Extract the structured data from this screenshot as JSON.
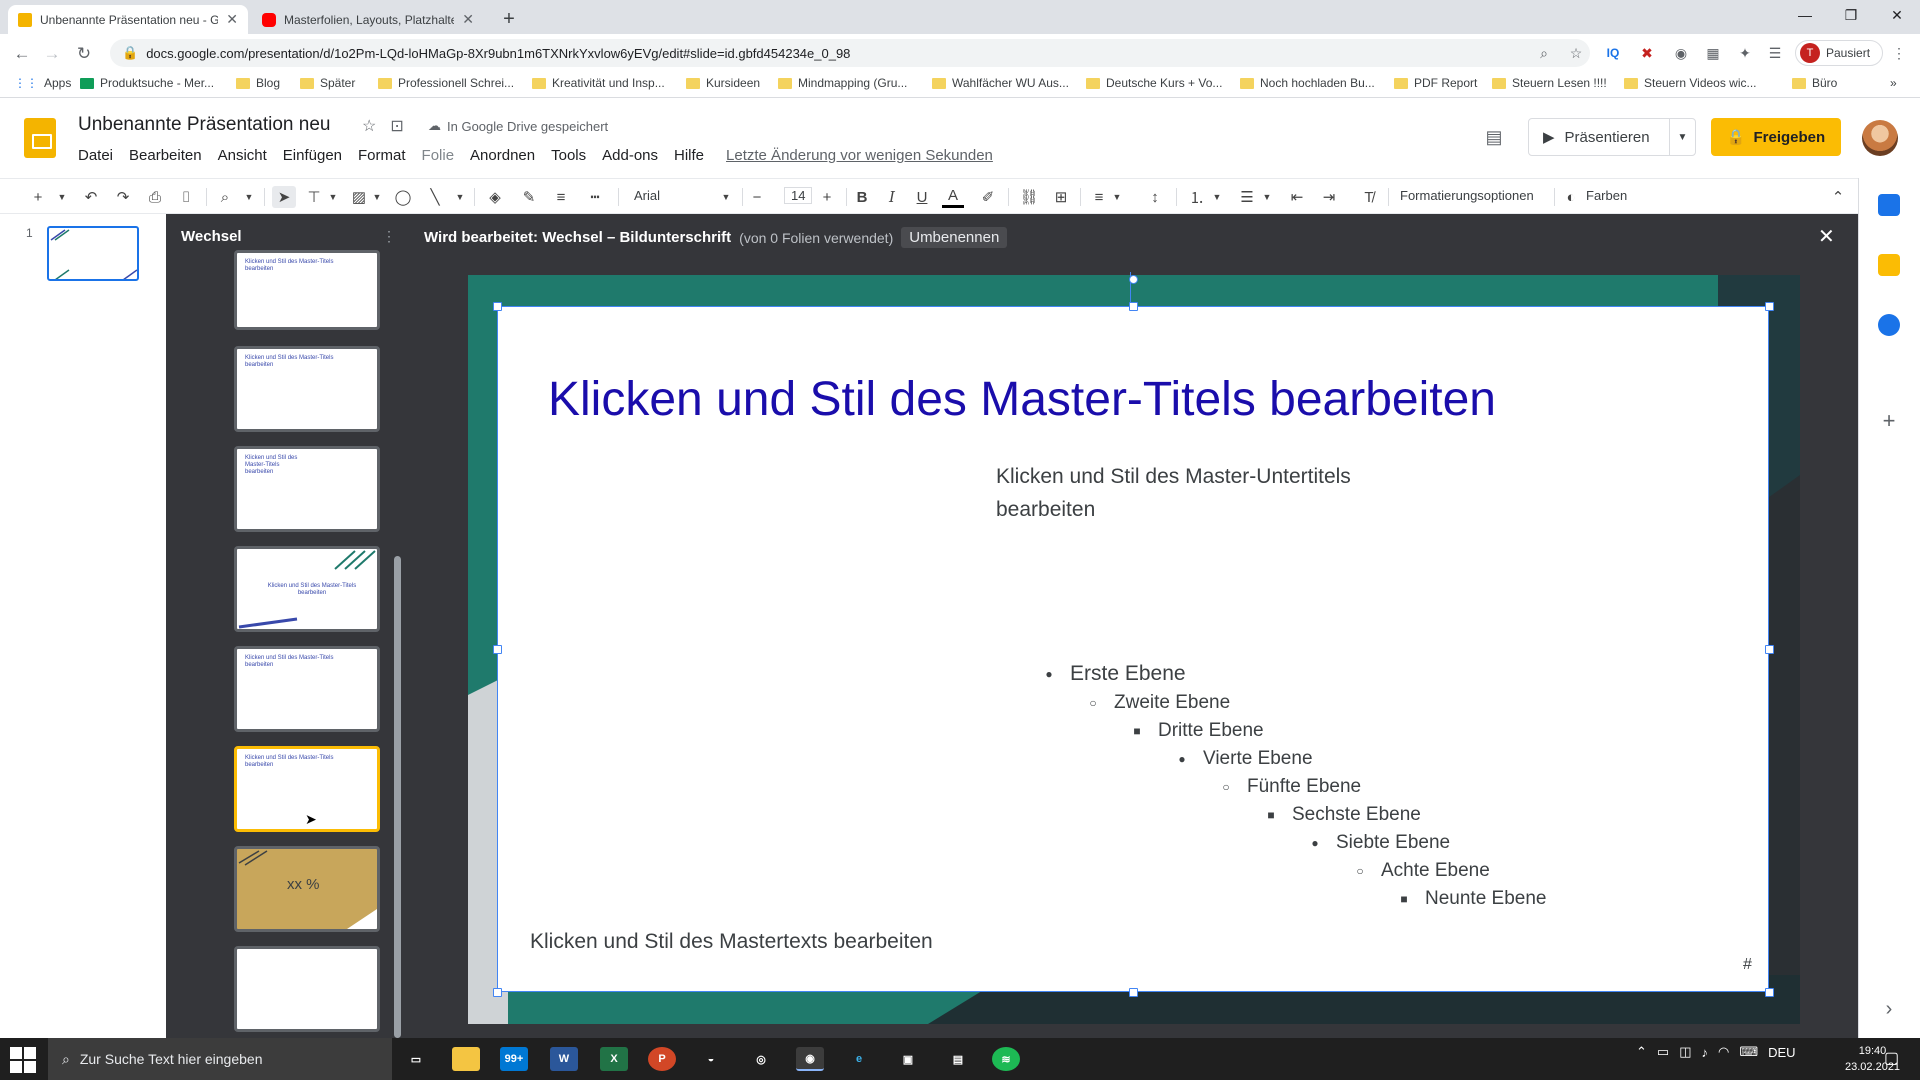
{
  "browser": {
    "tabs": [
      {
        "title": "Unbenannte Präsentation neu - G",
        "active": true
      },
      {
        "title": "Masterfolien, Layouts, Platzhalte",
        "active": false
      }
    ],
    "url": "docs.google.com/presentation/d/1o2Pm-LQd-loHMaGp-8Xr9ubn1m6TXNrkYxvlow6yEVg/edit#slide=id.gbfd454234e_0_98",
    "profile_initial": "T",
    "profile_label": "Pausiert",
    "bookmarks": [
      "Apps",
      "Produktsuche - Mer...",
      "Blog",
      "Später",
      "Professionell Schrei...",
      "Kreativität und Insp...",
      "Kursideen",
      "Mindmapping (Gru...",
      "Wahlfächer WU Aus...",
      "Deutsche Kurs + Vo...",
      "Noch hochladen Bu...",
      "PDF Report",
      "Steuern Lesen !!!!",
      "Steuern Videos wic...",
      "Büro"
    ]
  },
  "app": {
    "doc_title": "Unbenannte Präsentation neu",
    "save_status": "In Google Drive gespeichert",
    "menus": [
      "Datei",
      "Bearbeiten",
      "Ansicht",
      "Einfügen",
      "Format",
      "Folie",
      "Anordnen",
      "Tools",
      "Add-ons",
      "Hilfe"
    ],
    "last_change": "Letzte Änderung vor wenigen Sekunden",
    "present_label": "Präsentieren",
    "share_label": "Freigeben",
    "accent_color": "#fbbc04"
  },
  "toolbar": {
    "font": "Arial",
    "font_size": "14",
    "format_options": "Formatierungsoptionen",
    "colors": "Farben"
  },
  "filmstrip": {
    "slide_number": "1"
  },
  "master": {
    "layout_list_title": "Wechsel",
    "edit_label": "Wird bearbeitet: Wechsel – Bildunterschrift",
    "usage": "(von 0 Folien verwendet)",
    "rename": "Umbenennen",
    "thumbnails": [
      {
        "text": "Klicken und Stil des Master-Titels bearbeiten"
      },
      {
        "text": "Klicken und Stil des Master-Titels bearbeiten"
      },
      {
        "text": "Klicken und Stil des Master-Titels bearbeiten"
      },
      {
        "text": "Klicken und Stil des Master-Titels bearbeiten"
      },
      {
        "text": "Klicken und Stil des Master-Titels bearbeiten"
      },
      {
        "text": "Klicken und Stil des Master-Titels bearbeiten"
      },
      {
        "text": "xx %"
      },
      {
        "text": ""
      }
    ]
  },
  "slide": {
    "title": "Klicken und Stil des Master-Titels bearbeiten",
    "subtitle": "Klicken und Stil des Master-Untertitels bearbeiten",
    "levels": [
      {
        "bullet": "●",
        "text": "Erste Ebene"
      },
      {
        "bullet": "○",
        "text": "Zweite Ebene"
      },
      {
        "bullet": "■",
        "text": "Dritte Ebene"
      },
      {
        "bullet": "●",
        "text": "Vierte Ebene"
      },
      {
        "bullet": "○",
        "text": "Fünfte Ebene"
      },
      {
        "bullet": "■",
        "text": "Sechste Ebene"
      },
      {
        "bullet": "●",
        "text": "Siebte Ebene"
      },
      {
        "bullet": "○",
        "text": "Achte Ebene"
      },
      {
        "bullet": "■",
        "text": "Neunte Ebene"
      }
    ],
    "footer": "Klicken und Stil des Mastertexts bearbeiten",
    "number": "#",
    "title_color": "#1a0dab",
    "theme_color": "#1f7a6c"
  },
  "taskbar": {
    "search_placeholder": "Zur Suche Text hier eingeben",
    "mail_badge": "99+",
    "language": "DEU",
    "time": "19:40",
    "date": "23.02.2021"
  }
}
